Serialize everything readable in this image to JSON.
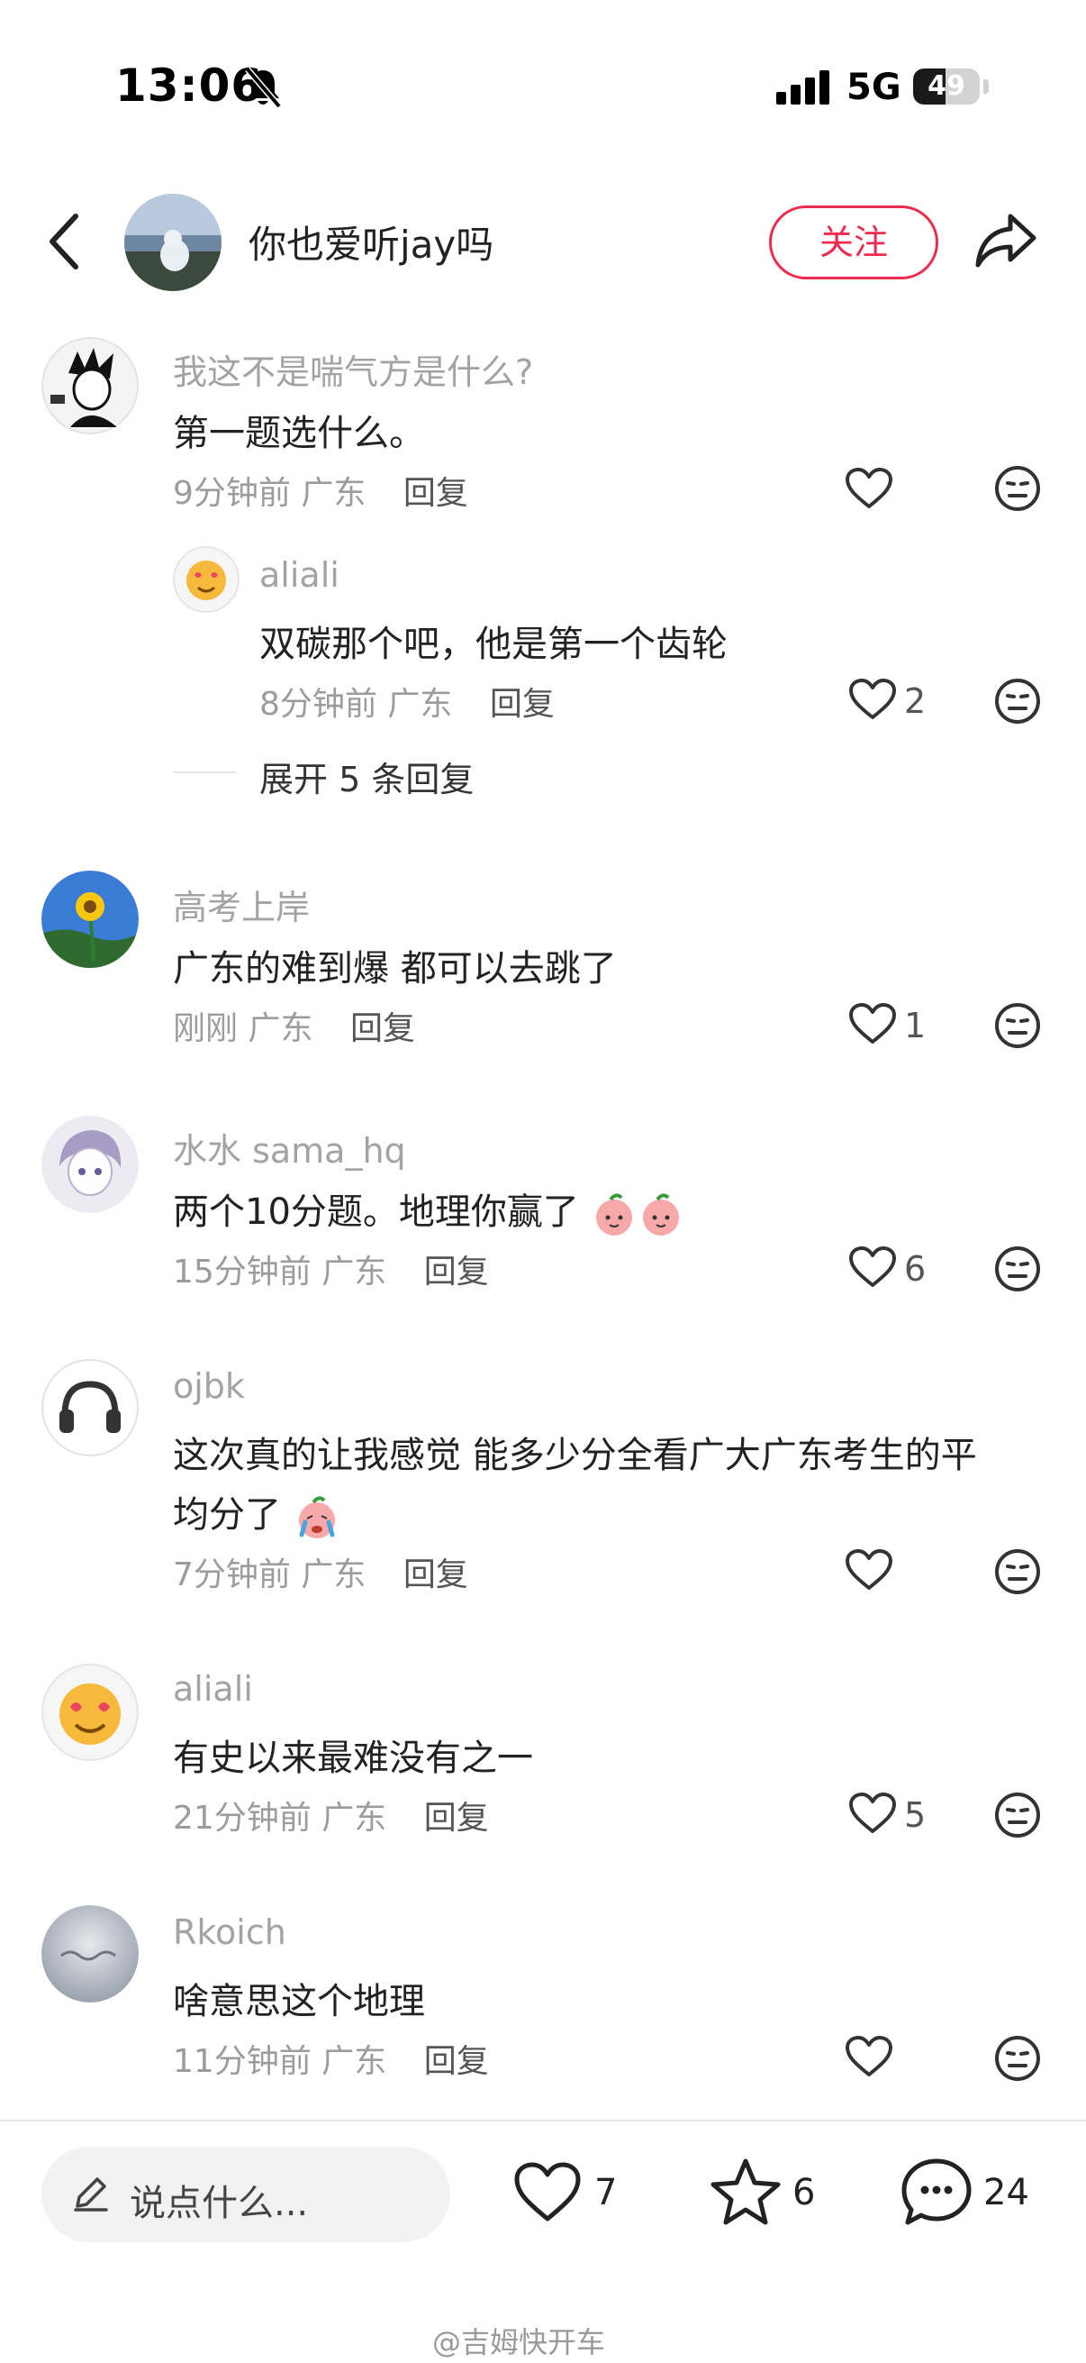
{
  "status_bar": {
    "time": "13:06",
    "network": "5G",
    "battery": "49",
    "battery_level": 0.49
  },
  "header": {
    "title": "你也爱听jay吗",
    "follow_label": "关注"
  },
  "comments": [
    {
      "name": "我这不是喘气方是什么?",
      "text": "第一题选什么。",
      "time": "9分钟前",
      "location": "广东",
      "reply_label": "回复",
      "likes": ""
    },
    {
      "name": "aliali",
      "text": "双碳那个吧，他是第一个齿轮",
      "time": "8分钟前",
      "location": "广东",
      "reply_label": "回复",
      "likes": "2"
    },
    {
      "name": "高考上岸",
      "text": "广东的难到爆 都可以去跳了",
      "time": "刚刚",
      "location": "广东",
      "reply_label": "回复",
      "likes": "1"
    },
    {
      "name": "水水 sama_hq",
      "text": "两个10分题。地理你赢了",
      "time": "15分钟前",
      "location": "广东",
      "reply_label": "回复",
      "likes": "6"
    },
    {
      "name": "ojbk",
      "text_line1": "这次真的让我感觉 能多少分全看广大广东考生的平",
      "text_line2": "均分了",
      "time": "7分钟前",
      "location": "广东",
      "reply_label": "回复",
      "likes": ""
    },
    {
      "name": "aliali",
      "text": "有史以来最难没有之一",
      "time": "21分钟前",
      "location": "广东",
      "reply_label": "回复",
      "likes": "5"
    },
    {
      "name": "Rkoich",
      "text": "啥意思这个地理",
      "time": "11分钟前",
      "location": "广东",
      "reply_label": "回复",
      "likes": ""
    }
  ],
  "expand_replies": "展开 5 条回复",
  "bottom_bar": {
    "input_placeholder": "说点什么...",
    "likes": "7",
    "favorites": "6",
    "comments": "24"
  },
  "watermark": "@吉姆快开车",
  "colors": {
    "accent": "#ee2a4f"
  }
}
